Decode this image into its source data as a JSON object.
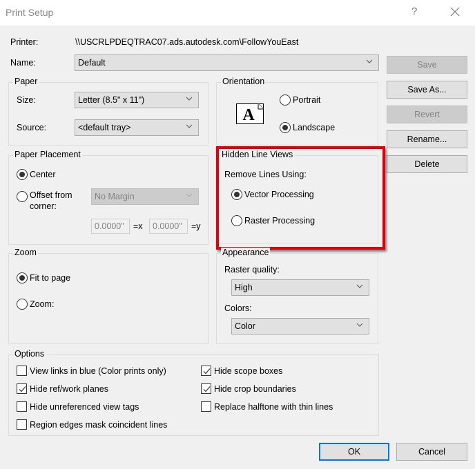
{
  "window": {
    "title": "Print Setup",
    "help_label": "?",
    "close_icon": "close-icon"
  },
  "printer": {
    "label": "Printer:",
    "value": "\\\\USCRLPDEQTRAC07.ads.autodesk.com\\FollowYouEast"
  },
  "name": {
    "label": "Name:",
    "value": "Default"
  },
  "side_buttons": {
    "save": "Save",
    "save_as": "Save As...",
    "revert": "Revert",
    "rename": "Rename...",
    "delete": "Delete"
  },
  "paper": {
    "legend": "Paper",
    "size_label": "Size:",
    "size_value": "Letter (8.5\" x 11\")",
    "source_label": "Source:",
    "source_value": "<default tray>"
  },
  "orientation": {
    "legend": "Orientation",
    "icon_glyph": "A",
    "portrait": "Portrait",
    "landscape": "Landscape",
    "selected": "Landscape"
  },
  "paper_placement": {
    "legend": "Paper Placement",
    "center": "Center",
    "offset_line1": "Offset from",
    "offset_line2": "corner:",
    "selected": "Center",
    "margin_value": "No Margin",
    "x_value": "0.0000\"",
    "x_label": "=x",
    "y_value": "0.0000\"",
    "y_label": "=y"
  },
  "hidden_line_views": {
    "legend": "Hidden Line Views",
    "remove_label": "Remove Lines Using:",
    "vector": "Vector Processing",
    "raster": "Raster Processing",
    "selected": "Vector Processing",
    "highlight_color": "#e0000b"
  },
  "zoom": {
    "legend": "Zoom",
    "fit": "Fit to page",
    "zoom": "Zoom:",
    "selected": "Fit to page"
  },
  "appearance": {
    "legend": "Appearance",
    "raster_label": "Raster quality:",
    "raster_value": "High",
    "colors_label": "Colors:",
    "colors_value": "Color"
  },
  "options": {
    "legend": "Options",
    "items": [
      {
        "label": "View links in blue (Color prints only)",
        "checked": false
      },
      {
        "label": "Hide ref/work planes",
        "checked": true
      },
      {
        "label": "Hide unreferenced view tags",
        "checked": false
      },
      {
        "label": "Region edges mask coincident lines",
        "checked": false
      },
      {
        "label": "Hide scope boxes",
        "checked": true
      },
      {
        "label": "Hide crop boundaries",
        "checked": true
      },
      {
        "label": "Replace halftone with thin lines",
        "checked": false
      }
    ]
  },
  "footer": {
    "ok": "OK",
    "cancel": "Cancel"
  }
}
